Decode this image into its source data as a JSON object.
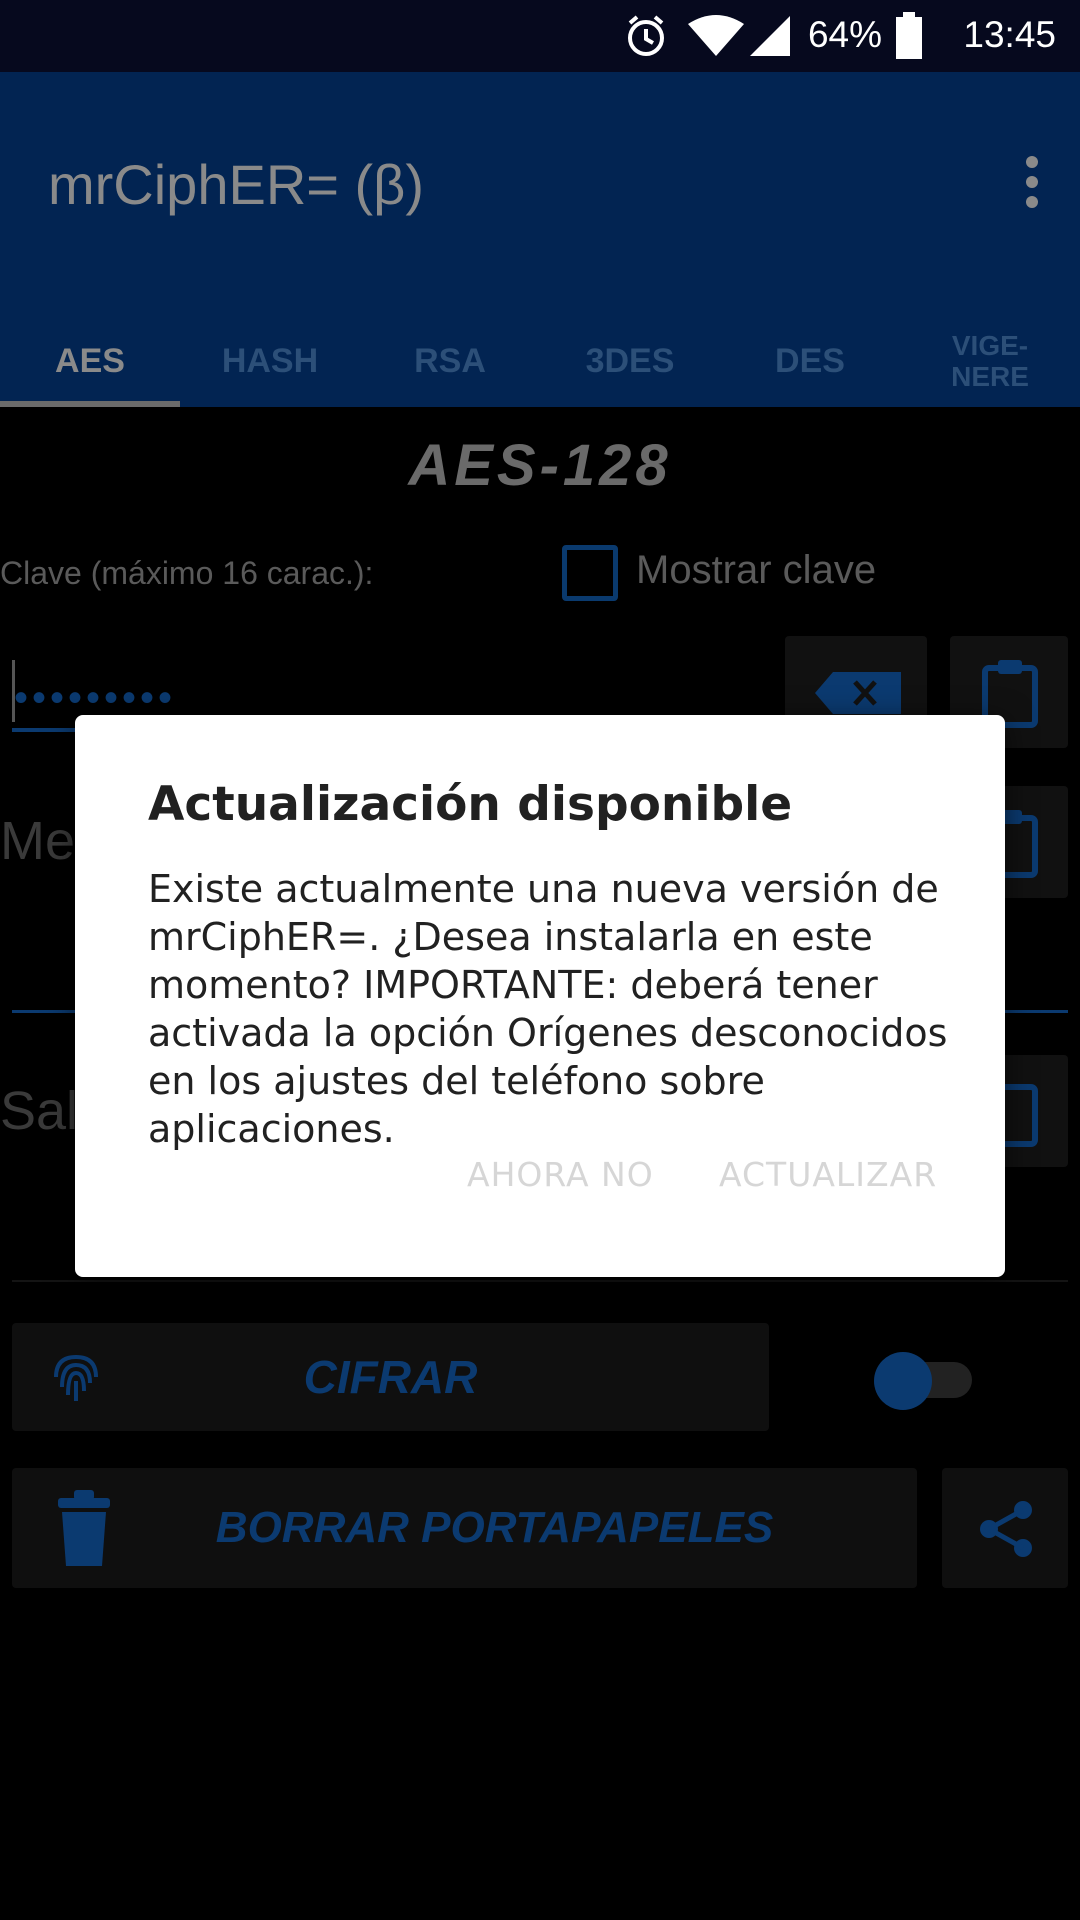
{
  "status_bar": {
    "battery": "64%",
    "time": "13:45"
  },
  "app": {
    "title": "mrCiphER= (β)"
  },
  "tabs": [
    {
      "label": "AES",
      "active": true
    },
    {
      "label": "HASH"
    },
    {
      "label": "RSA"
    },
    {
      "label": "3DES"
    },
    {
      "label": "DES"
    },
    {
      "label": "VIGE-\nNERE"
    }
  ],
  "content": {
    "cipher_title": "AES-128",
    "key_label": "Clave (máximo 16 carac.):",
    "show_key_label": "Mostrar clave",
    "password_dots": "•••••••••",
    "message_label": "Me",
    "output_label": "Sal",
    "encrypt_button": "CIFRAR",
    "clear_clipboard_button": "BORRAR PORTAPAPELES"
  },
  "dialog": {
    "title": "Actualización disponible",
    "body": "Existe actualmente una nueva versión de mrCiphER=. ¿Desea instalarla en este momento? IMPORTANTE: deberá tener activada la opción Orígenes desconocidos en los ajustes del teléfono sobre aplicaciones.",
    "negative_button": "AHORA NO",
    "positive_button": "ACTUALIZAR"
  },
  "colors": {
    "app_bar": "#022452",
    "accent": "#0b3a70"
  }
}
